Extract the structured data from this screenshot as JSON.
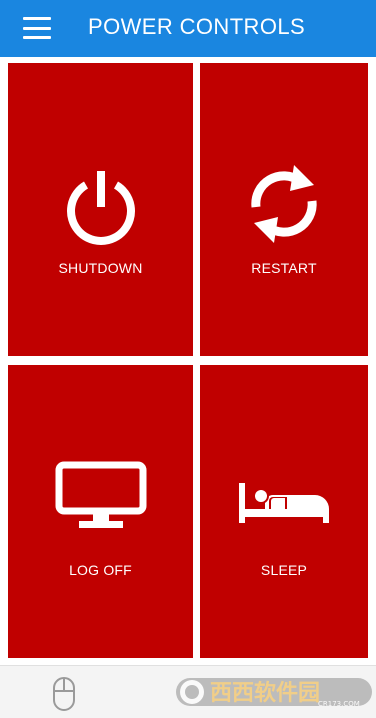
{
  "header": {
    "title": "POWER CONTROLS",
    "menu_icon": "hamburger-menu-icon",
    "color": "#1a86e0"
  },
  "tiles": [
    {
      "id": "shutdown",
      "label": "SHUTDOWN",
      "icon": "power-icon"
    },
    {
      "id": "restart",
      "label": "RESTART",
      "icon": "refresh-icon"
    },
    {
      "id": "logoff",
      "label": "LOG OFF",
      "icon": "monitor-icon"
    },
    {
      "id": "sleep",
      "label": "SLEEP",
      "icon": "bed-icon"
    }
  ],
  "tile_color": "#c00000",
  "bottom_bar": {
    "icon": "mouse-icon",
    "watermark": {
      "brand": "西西软件园",
      "url": "CR173.COM"
    }
  }
}
